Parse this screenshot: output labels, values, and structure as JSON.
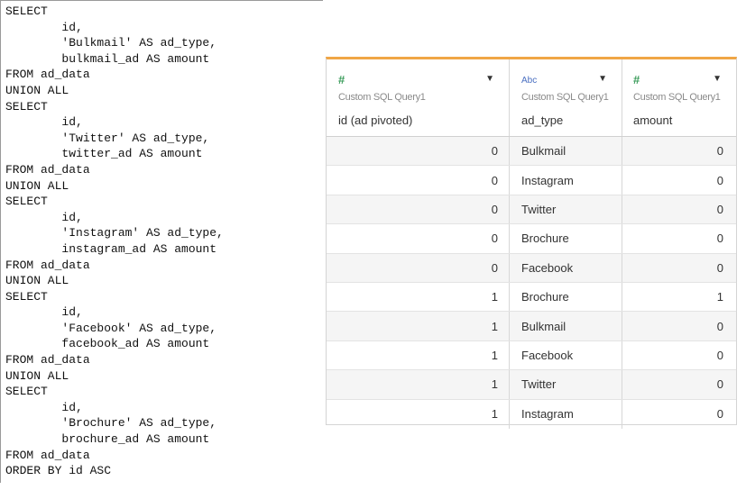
{
  "sql": {
    "lines": [
      "SELECT",
      "        id,",
      "        'Bulkmail' AS ad_type,",
      "        bulkmail_ad AS amount",
      "FROM ad_data",
      "UNION ALL",
      "SELECT",
      "        id,",
      "        'Twitter' AS ad_type,",
      "        twitter_ad AS amount",
      "FROM ad_data",
      "UNION ALL",
      "SELECT",
      "        id,",
      "        'Instagram' AS ad_type,",
      "        instagram_ad AS amount",
      "FROM ad_data",
      "UNION ALL",
      "SELECT",
      "        id,",
      "        'Facebook' AS ad_type,",
      "        facebook_ad AS amount",
      "FROM ad_data",
      "UNION ALL",
      "SELECT",
      "        id,",
      "        'Brochure' AS ad_type,",
      "        brochure_ad AS amount",
      "FROM ad_data",
      "ORDER BY id ASC"
    ]
  },
  "grid": {
    "columns": [
      {
        "icon": "#",
        "icon_name": "number-type-icon",
        "source": "Custom SQL Query1",
        "name": "id (ad pivoted)"
      },
      {
        "icon": "Abc",
        "icon_name": "string-type-icon",
        "source": "Custom SQL Query1",
        "name": "ad_type"
      },
      {
        "icon": "#",
        "icon_name": "number-type-icon",
        "source": "Custom SQL Query1",
        "name": "amount"
      }
    ],
    "dropdown_glyph": "▼",
    "rows": [
      {
        "id": "0",
        "ad_type": "Bulkmail",
        "amount": "0"
      },
      {
        "id": "0",
        "ad_type": "Instagram",
        "amount": "0"
      },
      {
        "id": "0",
        "ad_type": "Twitter",
        "amount": "0"
      },
      {
        "id": "0",
        "ad_type": "Brochure",
        "amount": "0"
      },
      {
        "id": "0",
        "ad_type": "Facebook",
        "amount": "0"
      },
      {
        "id": "1",
        "ad_type": "Brochure",
        "amount": "1"
      },
      {
        "id": "1",
        "ad_type": "Bulkmail",
        "amount": "0"
      },
      {
        "id": "1",
        "ad_type": "Facebook",
        "amount": "0"
      },
      {
        "id": "1",
        "ad_type": "Twitter",
        "amount": "0"
      },
      {
        "id": "1",
        "ad_type": "Instagram",
        "amount": "0"
      }
    ],
    "accent_color": "#f0a646"
  }
}
